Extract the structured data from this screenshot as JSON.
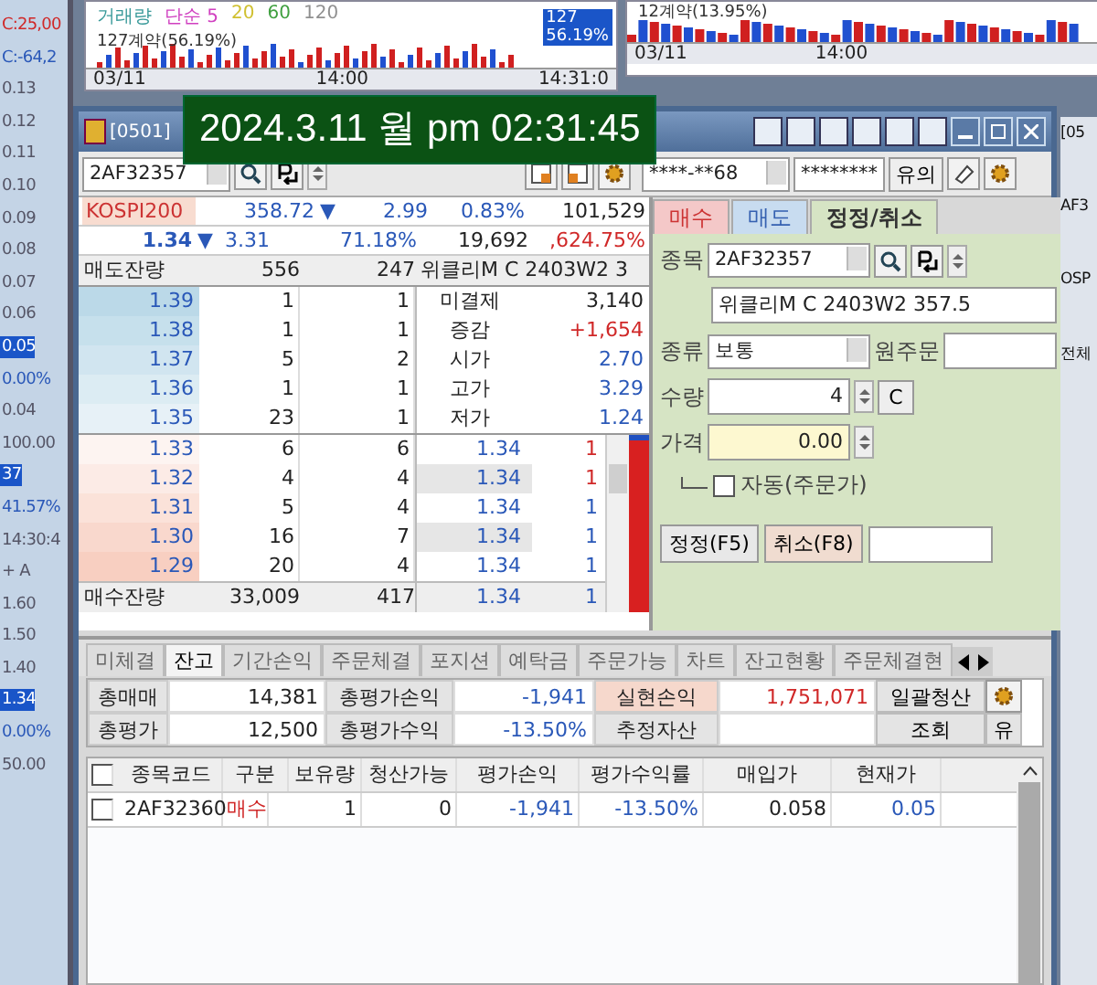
{
  "clock": "2024.3.11 월 pm 02:31:45",
  "left_strip": [
    {
      "text": "C:25,00",
      "kind": "up"
    },
    {
      "text": "C:-64,2",
      "kind": "down"
    },
    {
      "text": "0.13",
      "kind": "plain"
    },
    {
      "text": "0.12",
      "kind": "plain"
    },
    {
      "text": "0.11",
      "kind": "plain"
    },
    {
      "text": "0.10",
      "kind": "plain"
    },
    {
      "text": "0.09",
      "kind": "plain"
    },
    {
      "text": "0.08",
      "kind": "plain"
    },
    {
      "text": "0.07",
      "kind": "plain"
    },
    {
      "text": "0.06",
      "kind": "plain"
    },
    {
      "text": "0.05",
      "kind": "selected"
    },
    {
      "text": "0.00%",
      "kind": "down"
    },
    {
      "text": "0.04",
      "kind": "plain"
    },
    {
      "text": "100.00",
      "kind": "plain"
    },
    {
      "text": "37",
      "kind": "selected"
    },
    {
      "text": "41.57%",
      "kind": "down"
    },
    {
      "text": "14:30:4",
      "kind": "plain"
    },
    {
      "text": "+ A",
      "kind": "plain"
    },
    {
      "text": "1.60",
      "kind": "plain"
    },
    {
      "text": "1.50",
      "kind": "plain"
    },
    {
      "text": "1.40",
      "kind": "plain"
    },
    {
      "text": "1.34",
      "kind": "selected"
    },
    {
      "text": "0.00%",
      "kind": "down"
    },
    {
      "text": "50.00",
      "kind": "plain"
    }
  ],
  "chart_left": {
    "legend": [
      {
        "text": "거래량",
        "color": "#3a9a9a"
      },
      {
        "text": "단순 5",
        "color": "#d040c0"
      },
      {
        "text": "20",
        "color": "#d0c030"
      },
      {
        "text": "60",
        "color": "#40a040"
      },
      {
        "text": "120",
        "color": "#909090"
      }
    ],
    "volume": "127계약(56.19%)",
    "badge": [
      "127",
      "56.19%"
    ],
    "axis": [
      "03/11",
      "14:00",
      "14:31:0"
    ]
  },
  "chart_right": {
    "volume": "12계약(13.95%)",
    "axis": [
      "03/11",
      "14:00"
    ]
  },
  "window": {
    "screen": "[0501]",
    "code": "2AF32357",
    "account": "****-**68",
    "password": "********",
    "notice": "유의"
  },
  "quote": {
    "index": "KOSPI200",
    "index_value": "358.72",
    "arrow": "▼",
    "index_change": "2.99",
    "index_rate": "0.83%",
    "index_volume": "101,529",
    "price": "1.34",
    "price_arrow": "▼",
    "price_change": "3.31",
    "price_rate": "71.18%",
    "volume": "19,692",
    "rate": ",624.75%"
  },
  "book": {
    "ask_label": "매도잔량",
    "ask_qty": "556",
    "ask_count": "247",
    "name": "위클리M C 2403W2 3",
    "asks": [
      {
        "price": "1.39",
        "qty": "1",
        "count": "1",
        "label": "미결제",
        "value": "3,140",
        "kind": "plain"
      },
      {
        "price": "1.38",
        "qty": "1",
        "count": "1",
        "label": "증감",
        "value": "+1,654",
        "kind": "up"
      },
      {
        "price": "1.37",
        "qty": "5",
        "count": "2",
        "label": "시가",
        "value": "2.70",
        "kind": "down"
      },
      {
        "price": "1.36",
        "qty": "1",
        "count": "1",
        "label": "고가",
        "value": "3.29",
        "kind": "down"
      },
      {
        "price": "1.35",
        "qty": "23",
        "count": "1",
        "label": "저가",
        "value": "1.24",
        "kind": "down"
      }
    ],
    "bids": [
      {
        "price": "1.33",
        "qty": "6",
        "count": "6",
        "trade_price": "1.34",
        "trade_qty": "1",
        "kind": "up"
      },
      {
        "price": "1.32",
        "qty": "4",
        "count": "4",
        "trade_price": "1.34",
        "trade_qty": "1",
        "kind": "up"
      },
      {
        "price": "1.31",
        "qty": "5",
        "count": "4",
        "trade_price": "1.34",
        "trade_qty": "1",
        "kind": "down"
      },
      {
        "price": "1.30",
        "qty": "16",
        "count": "7",
        "trade_price": "1.34",
        "trade_qty": "1",
        "kind": "down"
      },
      {
        "price": "1.29",
        "qty": "20",
        "count": "4",
        "trade_price": "1.34",
        "trade_qty": "1",
        "kind": "down"
      }
    ],
    "bid_label": "매수잔량",
    "bid_qty": "33,009",
    "bid_count": "417",
    "bid_trade_price": "1.34",
    "bid_trade_qty": "1"
  },
  "order": {
    "tabs": [
      {
        "label": "매수",
        "kind": "buy",
        "selected": false
      },
      {
        "label": "매도",
        "kind": "sell",
        "selected": false
      },
      {
        "label": "정정/취소",
        "kind": "amend",
        "selected": true
      }
    ],
    "code_label": "종목",
    "code": "2AF32357",
    "name": "위클리M C 2403W2 357.5",
    "type_label": "종류",
    "type": "보통",
    "orig_label": "원주문",
    "qty_label": "수량",
    "qty": "4",
    "clear": "C",
    "price_label": "가격",
    "price": "0.00",
    "auto": {
      "label": "자동(주문가)",
      "checked": false
    },
    "buttons": [
      "정정(F5)",
      "취소(F8)"
    ]
  },
  "bottom_tabs": [
    {
      "label": "미체결",
      "selected": false
    },
    {
      "label": "잔고",
      "selected": true
    },
    {
      "label": "기간손익",
      "selected": false
    },
    {
      "label": "주문체결",
      "selected": false
    },
    {
      "label": "포지션",
      "selected": false
    },
    {
      "label": "예탁금",
      "selected": false
    },
    {
      "label": "주문가능",
      "selected": false
    },
    {
      "label": "차트",
      "selected": false
    },
    {
      "label": "잔고현황",
      "selected": false
    },
    {
      "label": "주문체결현",
      "selected": false
    }
  ],
  "summary": [
    [
      {
        "label": "총매매",
        "value": "14,381",
        "kind": "plain"
      },
      {
        "label": "총평가손익",
        "value": "-1,941",
        "kind": "down"
      },
      {
        "label": "실현손익",
        "value": "1,751,071",
        "kind": "up"
      }
    ],
    [
      {
        "label": "총평가",
        "value": "12,500",
        "kind": "plain"
      },
      {
        "label": "총평가수익",
        "value": "-13.50%",
        "kind": "down"
      },
      {
        "label": "추정자산",
        "kind": "plain"
      }
    ]
  ],
  "summary_buttons": [
    "일괄청산",
    "조회",
    "유"
  ],
  "table": {
    "select_all": {
      "checked": false
    },
    "columns": [
      "종목코드",
      "구분",
      "보유량",
      "청산가능",
      "평가손익",
      "평가수익률",
      "매입가",
      "현재가"
    ],
    "rows": [
      {
        "checked": false,
        "cells": [
          "2AF32360",
          "매수",
          "1",
          "0",
          "-1,941",
          "-13.50%",
          "0.058",
          "0.05"
        ]
      }
    ]
  },
  "right_strip": [
    "[05",
    "AF3",
    "OSP",
    "전체"
  ]
}
